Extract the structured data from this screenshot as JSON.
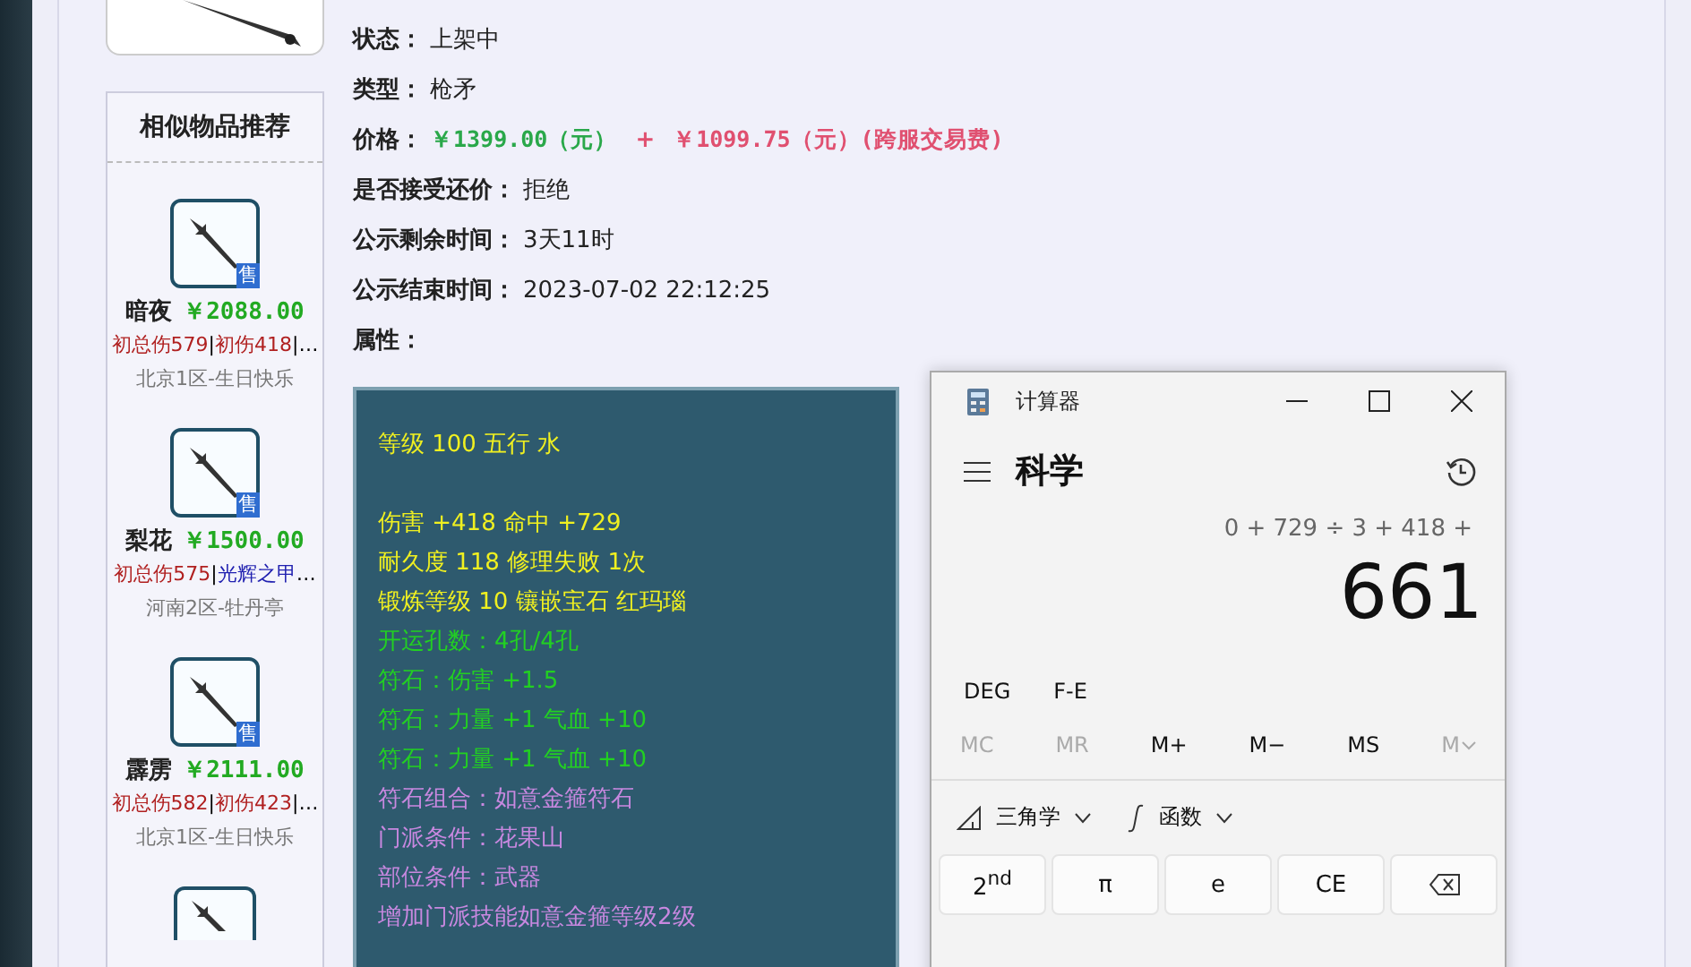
{
  "sidebar": {
    "title": "相似物品推荐",
    "items": [
      {
        "badge": "售",
        "name": "暗夜",
        "price": "￥2088.00",
        "tags": [
          {
            "kind": "tag",
            "text": "初总伤579",
            "color": "#b02020"
          },
          {
            "kind": "sep",
            "text": "|"
          },
          {
            "kind": "tag",
            "text": "初伤418",
            "color": "#b02020"
          },
          {
            "kind": "sep",
            "text": "|…"
          }
        ],
        "server": "北京1区-生日快乐"
      },
      {
        "badge": "售",
        "name": "梨花",
        "price": "￥1500.00",
        "tags": [
          {
            "kind": "tag",
            "text": "初总伤575",
            "color": "#b02020"
          },
          {
            "kind": "sep",
            "text": "|"
          },
          {
            "kind": "tag",
            "text": "光辉之甲",
            "color": "#2020b0"
          },
          {
            "kind": "sep",
            "text": "…"
          }
        ],
        "server": "河南2区-牡丹亭"
      },
      {
        "badge": "售",
        "name": "霹雳",
        "price": "￥2111.00",
        "tags": [
          {
            "kind": "tag",
            "text": "初总伤582",
            "color": "#b02020"
          },
          {
            "kind": "sep",
            "text": "|"
          },
          {
            "kind": "tag",
            "text": "初伤423",
            "color": "#b02020"
          },
          {
            "kind": "sep",
            "text": "|…"
          }
        ],
        "server": "北京1区-生日快乐"
      }
    ]
  },
  "details": {
    "fields": [
      {
        "kind": "text",
        "label": "状态：",
        "value": "上架中"
      },
      {
        "kind": "text",
        "label": "类型：",
        "value": "枪矛"
      },
      {
        "kind": "price",
        "label": "价格：",
        "base": "￥1399.00（元）",
        "plus": "+",
        "fee": "￥1099.75（元）(跨服交易费)"
      },
      {
        "kind": "text",
        "label": "是否接受还价：",
        "value": "拒绝"
      },
      {
        "kind": "text",
        "label": "公示剩余时间：",
        "value": "3天11时"
      },
      {
        "kind": "text",
        "label": "公示结束时间：",
        "value": "2023-07-02 22:12:25"
      },
      {
        "kind": "text",
        "label": "属性："
      }
    ],
    "attribute_groups": [
      {
        "lines": [
          {
            "text": "等级 100 五行 水",
            "color": "#f0f020"
          }
        ]
      },
      {
        "lines": [
          {
            "text": "伤害 +418 命中 +729",
            "color": "#f0f020"
          },
          {
            "text": "耐久度 118 修理失败 1次",
            "color": "#f0f020"
          },
          {
            "text": "锻炼等级 10 镶嵌宝石 红玛瑙",
            "color": "#f0f020"
          },
          {
            "text": "开运孔数：4孔/4孔",
            "color": "#22d022"
          },
          {
            "text": "符石：伤害 +1.5",
            "color": "#22d022"
          },
          {
            "text": "符石：力量 +1 气血 +10",
            "color": "#22d022"
          },
          {
            "text": "符石：力量 +1 气血 +10",
            "color": "#22d022"
          },
          {
            "text": "符石组合：如意金箍符石",
            "color": "#c888e0"
          },
          {
            "text": "门派条件：花果山",
            "color": "#c888e0"
          },
          {
            "text": "部位条件：武器",
            "color": "#c888e0"
          },
          {
            "text": "增加门派技能如意金箍等级2级",
            "color": "#c888e0"
          }
        ]
      }
    ]
  },
  "calculator": {
    "title": "计算器",
    "mode": "科学",
    "expression": "0 + 729 ÷ 3 + 418 +",
    "result": "661",
    "modes": [
      "DEG",
      "F-E"
    ],
    "memory": [
      {
        "label": "MC",
        "disabled": true,
        "kind": "text"
      },
      {
        "label": "MR",
        "disabled": true,
        "kind": "text"
      },
      {
        "label": "M+",
        "disabled": false,
        "kind": "text"
      },
      {
        "label": "M−",
        "disabled": false,
        "kind": "text"
      },
      {
        "label": "MS",
        "disabled": false,
        "kind": "text"
      },
      {
        "label": "M",
        "disabled": true,
        "kind": "menu"
      }
    ],
    "toolbar": [
      {
        "label": "三角学",
        "kind": "trig"
      },
      {
        "label": "函数",
        "kind": "func"
      }
    ],
    "keys": [
      {
        "label": "2$^{nd}$",
        "kind": "text"
      },
      {
        "label": "π",
        "kind": "text"
      },
      {
        "label": "e",
        "kind": "text"
      },
      {
        "label": "CE",
        "kind": "text"
      },
      {
        "kind": "backspace"
      }
    ]
  }
}
